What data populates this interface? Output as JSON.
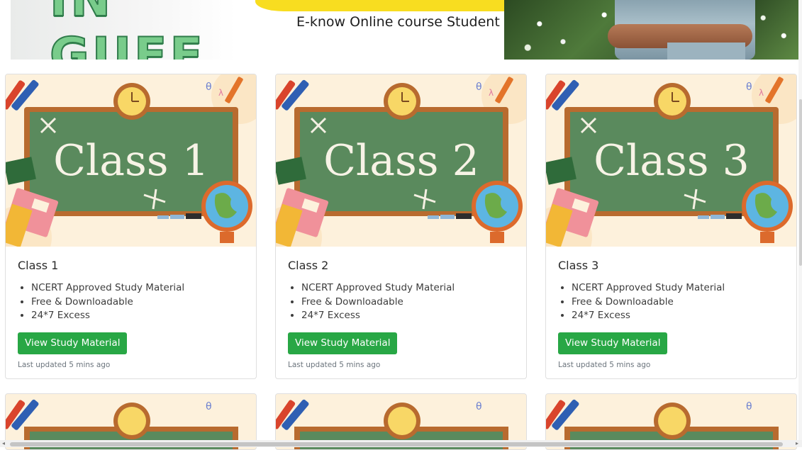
{
  "banner": {
    "big_text": "IN GUEE",
    "subtitle": "E-know Online course Student"
  },
  "cards": [
    {
      "image_text": "Class 1",
      "title": "Class 1",
      "features": [
        "NCERT Approved Study Material",
        "Free & Downloadable",
        "24*7 Excess"
      ],
      "button_label": "View Study Material",
      "updated": "Last updated 5 mins ago"
    },
    {
      "image_text": "Class 2",
      "title": "Class 2",
      "features": [
        "NCERT Approved Study Material",
        "Free & Downloadable",
        "24*7 Excess"
      ],
      "button_label": "View Study Material",
      "updated": "Last updated 5 mins ago"
    },
    {
      "image_text": "Class 3",
      "title": "Class 3",
      "features": [
        "NCERT Approved Study Material",
        "Free & Downloadable",
        "24*7 Excess"
      ],
      "button_label": "View Study Material",
      "updated": "Last updated 5 mins ago"
    }
  ],
  "colors": {
    "button": "#28a745",
    "chalkboard": "#5a8a5d",
    "board_frame": "#b86b2f",
    "banner_stripe": "#f8dd20"
  },
  "icons": {
    "clock": "clock-icon",
    "globe": "globe-icon",
    "book": "book-icon",
    "crayon": "crayon-icon"
  }
}
